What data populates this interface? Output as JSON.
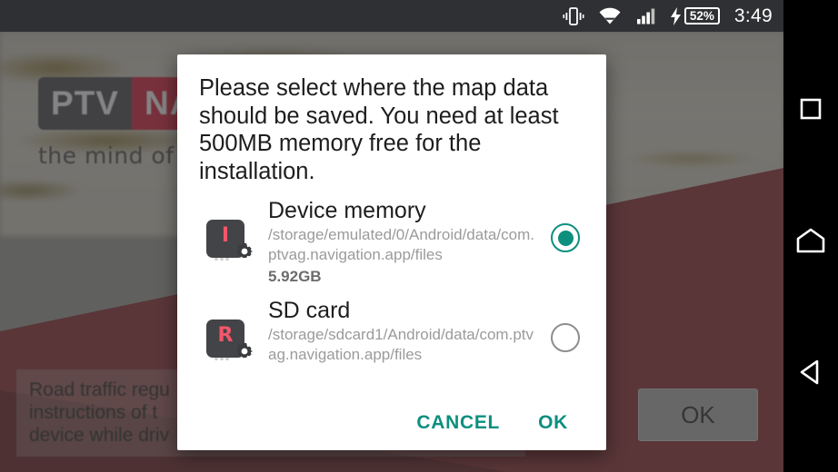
{
  "status_bar": {
    "icons": [
      "vibrate-icon",
      "wifi-icon",
      "signal-icon",
      "charging-bolt-icon"
    ],
    "battery_percent": "52%",
    "clock": "3:49"
  },
  "app_background": {
    "logo": {
      "part1": "PTV",
      "part2": "NA",
      "tagline": "the mind of n"
    },
    "disclaimer_text": "Road traffic regu\ninstructions of t\ndevice while driv",
    "ok_button": "OK"
  },
  "dialog": {
    "message": "Please select where the map data should be saved. You need at least 500MB memory free for the installation.",
    "options": [
      {
        "icon": "internal-storage-icon",
        "icon_letter": "I",
        "title": "Device memory",
        "path": "/storage/emulated/0/Android/data/com.ptvag.navigation.app/files",
        "size": "5.92GB",
        "selected": true
      },
      {
        "icon": "sd-card-icon",
        "icon_letter": "R",
        "title": "SD card",
        "path": "/storage/sdcard1/Android/data/com.ptvag.navigation.app/files",
        "size": "",
        "selected": false
      }
    ],
    "cancel_label": "CANCEL",
    "ok_label": "OK"
  },
  "nav_bar": {
    "recents": "recents-square-icon",
    "home": "home-icon",
    "back": "back-triangle-icon"
  },
  "colors": {
    "accent_teal": "#0d8f7e",
    "status_bar_bg": "#2f3033",
    "brand_red": "#c8102e",
    "dialog_bg": "#ffffff"
  }
}
